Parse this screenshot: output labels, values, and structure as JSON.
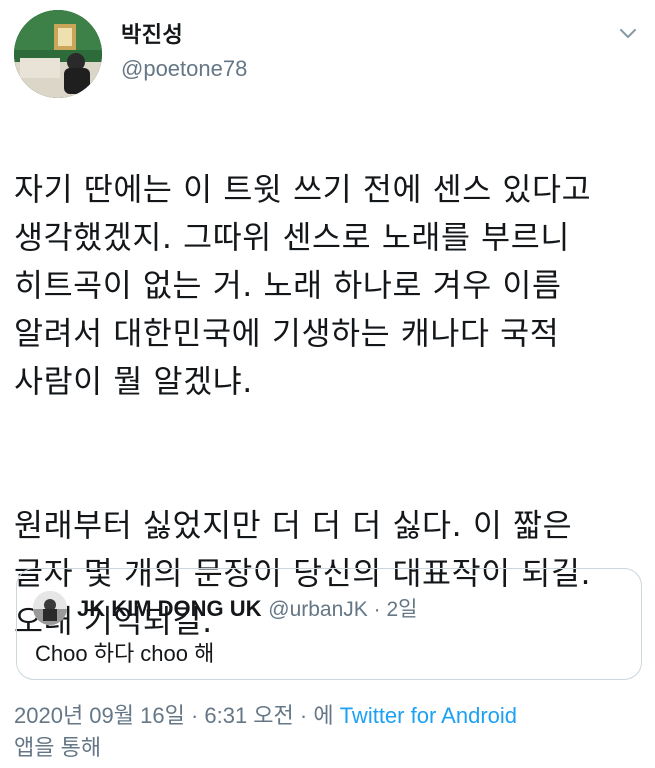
{
  "author": {
    "display_name": "박진성",
    "handle": "@poetone78"
  },
  "tweet": {
    "paragraph1": "자기 딴에는 이 트윗 쓰기 전에 센스 있다고\n생각했겠지. 그따위 센스로 노래를 부르니\n히트곡이 없는 거. 노래 하나로 겨우 이름\n알려서 대한민국에 기생하는 캐나다 국적\n사람이 뭘 알겠냐.",
    "paragraph2": "원래부터 싫었지만 더 더 더 싫다. 이 짧은\n글자 몇 개의 문장이 당신의 대표작이 되길.\n오래 기억되길."
  },
  "quoted_tweet": {
    "display_name": "JK KIM DONG UK",
    "handle": "@urbanJK",
    "separator": " · ",
    "time": "2일",
    "text": "Choo 하다 choo 해"
  },
  "meta": {
    "datetime": "2020년 09월 16일 · 6:31 오전 · 에 ",
    "source": "Twitter for Android",
    "suffix": "앱을 통해"
  },
  "icons": {
    "more": "chevron-down-icon"
  },
  "colors": {
    "link": "#1da1f2",
    "secondary_text": "#657786",
    "border": "#ccd6dd"
  }
}
